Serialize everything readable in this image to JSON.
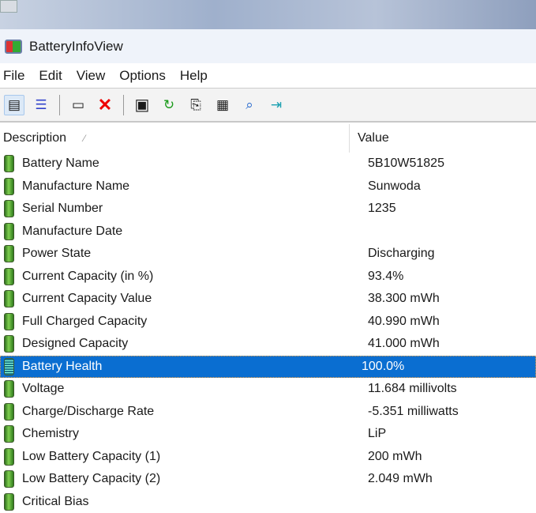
{
  "window": {
    "title": "BatteryInfoView"
  },
  "menu": [
    "File",
    "Edit",
    "View",
    "Options",
    "Help"
  ],
  "toolbar": [
    {
      "name": "html-report-icon"
    },
    {
      "name": "clipboard-list-icon"
    },
    {
      "name": "window-icon"
    },
    {
      "name": "delete-icon"
    },
    {
      "name": "save-icon"
    },
    {
      "name": "refresh-icon"
    },
    {
      "name": "copy-icon"
    },
    {
      "name": "properties-icon"
    },
    {
      "name": "find-icon"
    },
    {
      "name": "exit-icon"
    }
  ],
  "columns": {
    "description": "Description",
    "sort_indicator": "⁄",
    "value": "Value"
  },
  "rows": [
    {
      "d": "Battery Name",
      "v": "5B10W51825"
    },
    {
      "d": "Manufacture Name",
      "v": "Sunwoda"
    },
    {
      "d": "Serial Number",
      "v": " 1235"
    },
    {
      "d": "Manufacture Date",
      "v": ""
    },
    {
      "d": "Power State",
      "v": "Discharging"
    },
    {
      "d": "Current Capacity (in %)",
      "v": "93.4%"
    },
    {
      "d": "Current Capacity Value",
      "v": "38.300 mWh"
    },
    {
      "d": "Full Charged Capacity",
      "v": "40.990 mWh"
    },
    {
      "d": "Designed Capacity",
      "v": "41.000 mWh"
    },
    {
      "d": "Battery Health",
      "v": "100.0%",
      "selected": true
    },
    {
      "d": "Voltage",
      "v": "11.684 millivolts"
    },
    {
      "d": "Charge/Discharge Rate",
      "v": "-5.351 milliwatts"
    },
    {
      "d": "Chemistry",
      "v": "LiP"
    },
    {
      "d": "Low Battery Capacity (1)",
      "v": "200 mWh"
    },
    {
      "d": "Low Battery Capacity (2)",
      "v": "2.049 mWh"
    },
    {
      "d": "Critical Bias",
      "v": ""
    }
  ],
  "colors": {
    "selection": "#0a6ed1"
  }
}
